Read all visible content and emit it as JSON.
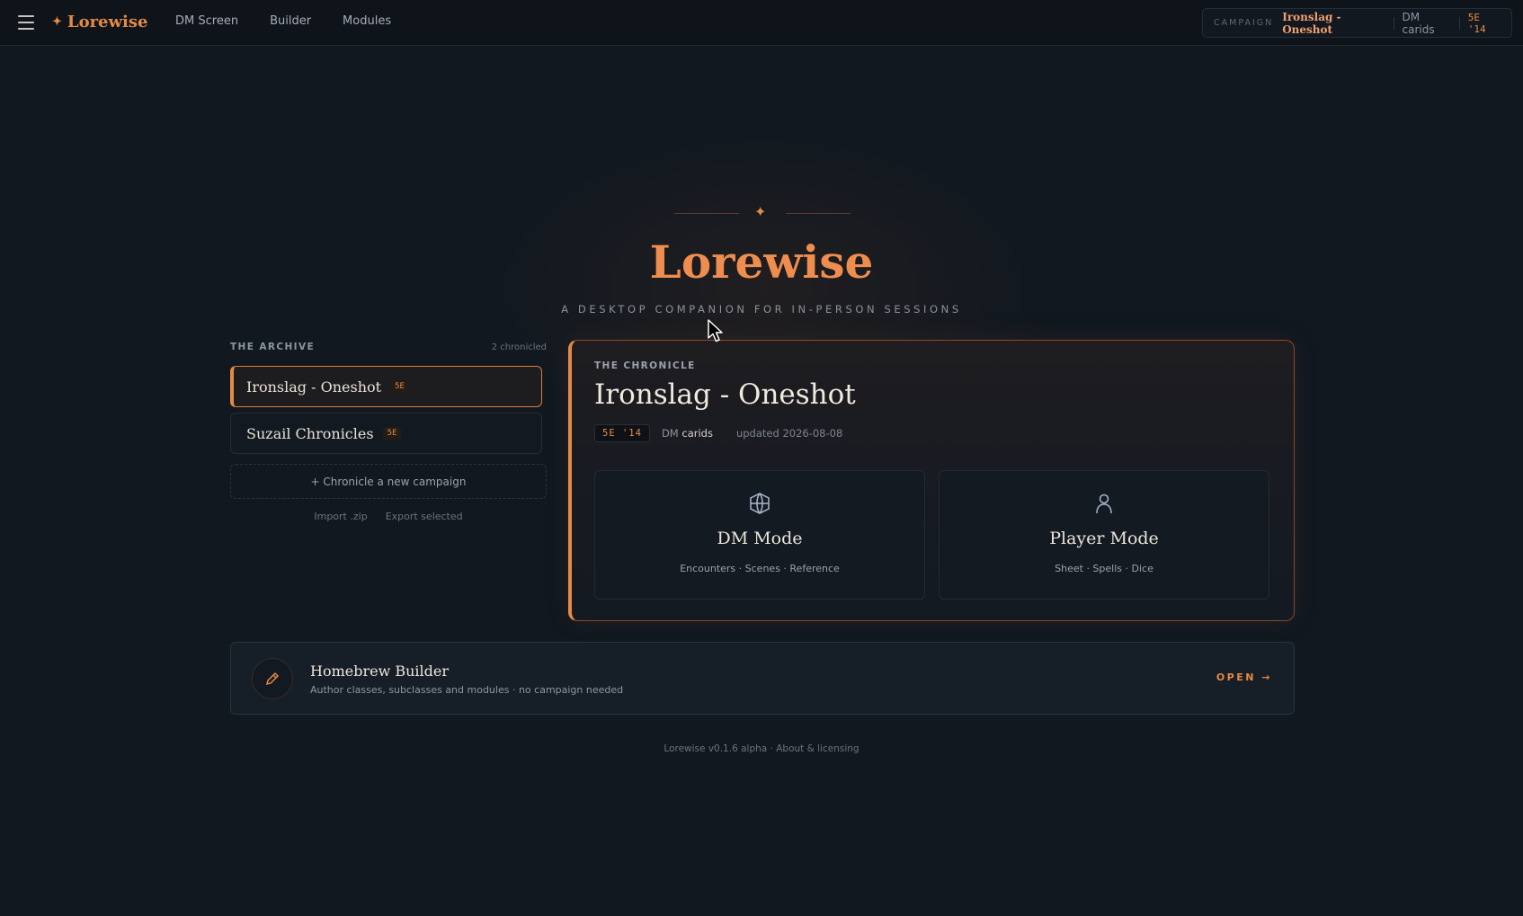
{
  "app": {
    "brand": "Lorewise",
    "nav": [
      "DM Screen",
      "Builder",
      "Modules"
    ]
  },
  "campaign_pill": {
    "label": "CAMPAIGN",
    "name": "Ironslag - Oneshot",
    "dm": "DM carids",
    "edition": "5E '14"
  },
  "hero": {
    "ornament": "✦",
    "title": "Lorewise",
    "subtitle": "A DESKTOP COMPANION FOR IN-PERSON SESSIONS"
  },
  "archive": {
    "title": "THE ARCHIVE",
    "count": "2 chronicled",
    "campaigns": [
      {
        "name": "Ironslag - Oneshot",
        "badge": "5E",
        "active": true
      },
      {
        "name": "Suzail Chronicles",
        "badge": "5E",
        "active": false
      }
    ],
    "new_label": "+ Chronicle a new campaign",
    "import_label": "Import .zip",
    "export_label": "Export selected"
  },
  "chronicle": {
    "eyebrow": "THE CHRONICLE",
    "title": "Ironslag - Oneshot",
    "edition": "5E '14",
    "dm_prefix": "DM",
    "dm_name": "carids",
    "updated": "updated 2026-08-08",
    "modes": [
      {
        "name": "DM Mode",
        "sub": "Encounters · Scenes · Reference",
        "icon": "globe-icon"
      },
      {
        "name": "Player Mode",
        "sub": "Sheet · Spells · Dice",
        "icon": "person-icon"
      }
    ]
  },
  "homebrew": {
    "title": "Homebrew Builder",
    "sub": "Author classes, subclasses and modules · no campaign needed",
    "open": "OPEN →",
    "icon": "pencil-icon"
  },
  "footer": {
    "version": "Lorewise v0.1.6 alpha",
    "sep": " · ",
    "link": "About & licensing"
  },
  "colors": {
    "accent": "#e58a45",
    "background": "#111820"
  }
}
